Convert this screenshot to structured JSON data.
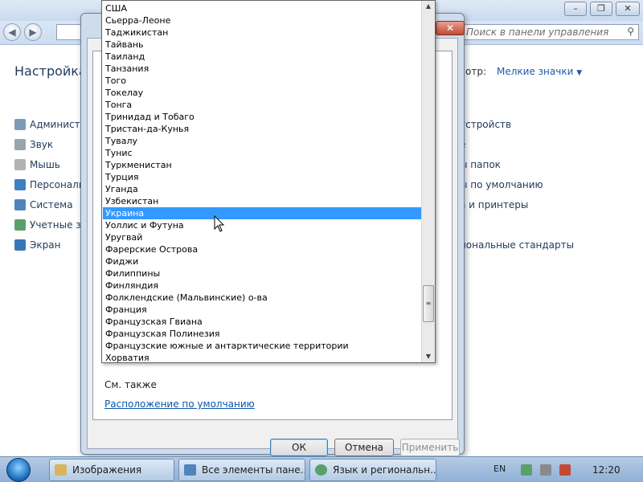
{
  "control_panel": {
    "search_placeholder": "Поиск в панели управления",
    "heading": "Настройка п",
    "view_by_label": "мотр:",
    "view_by_value": "Мелкие значки",
    "left_items": [
      "Админист",
      "Звук",
      "Мышь",
      "Персонали",
      "Система",
      "Учетные за",
      "Экран"
    ],
    "right_items": [
      "устройств",
      "е",
      "ы папок",
      "ы по умолчанию",
      "а и принтеры",
      "иональные стандарты"
    ]
  },
  "dialog": {
    "close_label": "✕",
    "see_also": "См. также",
    "default_location_link": "Расположение по умолчанию",
    "ok_label": "ОК",
    "cancel_label": "Отмена",
    "apply_label": "Применить"
  },
  "dropdown": {
    "selected_index": 17,
    "items": [
      "США",
      "Сьерра-Леоне",
      "Таджикистан",
      "Тайвань",
      "Таиланд",
      "Танзания",
      "Того",
      "Токелау",
      "Тонга",
      "Тринидад и Тобаго",
      "Тристан-да-Кунья",
      "Тувалу",
      "Тунис",
      "Туркменистан",
      "Турция",
      "Уганда",
      "Узбекистан",
      "Украина",
      "Уоллис и Футуна",
      "Уругвай",
      "Фарерские Острова",
      "Фиджи",
      "Филиппины",
      "Финляндия",
      "Фолклендские (Мальвинские) о-ва",
      "Франция",
      "Французская Гвиана",
      "Французская Полинезия",
      "Французские южные и антарктические территории",
      "Хорватия"
    ]
  },
  "taskbar": {
    "buttons": [
      "Изображения",
      "Все элементы пане...",
      "Язык и региональн..."
    ],
    "language": "EN",
    "clock": "12:20"
  }
}
